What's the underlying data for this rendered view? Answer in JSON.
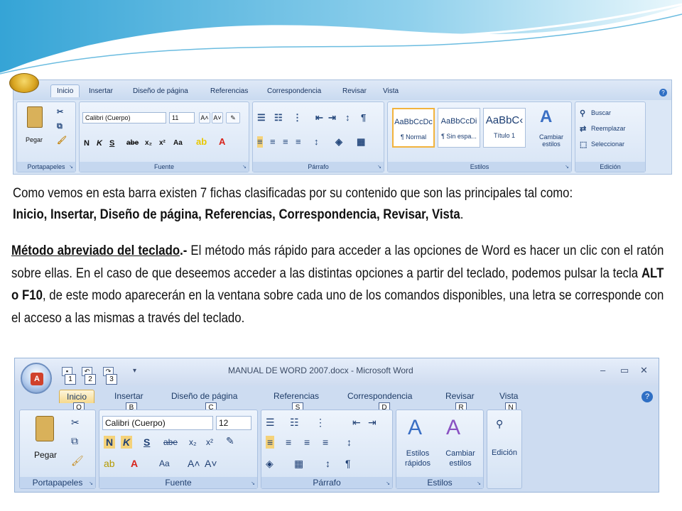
{
  "ribbon1": {
    "tabs": [
      "Inicio",
      "Insertar",
      "Diseño de página",
      "Referencias",
      "Correspondencia",
      "Revisar",
      "Vista"
    ],
    "groups": {
      "portapapeles": {
        "label": "Portapapeles",
        "paste_label": "Pegar"
      },
      "fuente": {
        "label": "Fuente",
        "font_name": "Calibri (Cuerpo)",
        "font_size": "11"
      },
      "parrafo": {
        "label": "Párrafo"
      },
      "estilos": {
        "label": "Estilos",
        "styles": [
          {
            "sample": "AaBbCcDc",
            "name": "¶ Normal"
          },
          {
            "sample": "AaBbCcDi",
            "name": "¶ Sin espa..."
          },
          {
            "sample": "AaBbC‹",
            "name": "Título 1"
          }
        ],
        "change_styles": "Cambiar estilos"
      },
      "edicion": {
        "label": "Edición",
        "buscar": "Buscar",
        "reemplazar": "Reemplazar",
        "seleccionar": "Seleccionar"
      }
    }
  },
  "paragraph1": {
    "text": "Como vemos en esta barra existen 7 fichas clasificadas por su contenido que son las principales tal como: ",
    "bold": "Inicio, Insertar, Diseño de página, Referencias, Correspondencia, Revisar, Vista",
    "end": "."
  },
  "paragraph2": {
    "lead": "Método abreviado del teclado",
    "dash": ".- ",
    "part1": " El método más rápido para acceder a las opciones de Word es hacer un clic con el ratón sobre ellas. En el caso de que deseemos acceder a las distintas opciones a partir del teclado, podemos pulsar la tecla ",
    "keys": "ALT o F10",
    "part2": ", de este modo aparecerán en la ventana sobre cada uno de los comandos disponibles, una letra se corresponde con el acceso a las mismas a través del teclado."
  },
  "ribbon2": {
    "window_title": "MANUAL DE WORD 2007.docx - Microsoft Word",
    "qat_keys": [
      "1",
      "2",
      "3"
    ],
    "tabs": [
      {
        "label": "Inicio",
        "key": "O"
      },
      {
        "label": "Insertar",
        "key": "B"
      },
      {
        "label": "Diseño de página",
        "key": "C"
      },
      {
        "label": "Referencias",
        "key": "S"
      },
      {
        "label": "Correspondencia",
        "key": "D"
      },
      {
        "label": "Revisar",
        "key": "R"
      },
      {
        "label": "Vista",
        "key": "N"
      }
    ],
    "groups": {
      "portapapeles": {
        "label": "Portapapeles",
        "paste_label": "Pegar"
      },
      "fuente": {
        "label": "Fuente",
        "font_name": "Calibri (Cuerpo)",
        "font_size": "12"
      },
      "parrafo": {
        "label": "Párrafo"
      },
      "estilos": {
        "label": "Estilos",
        "quick_styles": "Estilos rápidos",
        "change_styles": "Cambiar estilos"
      },
      "edicion": {
        "label": "Edición"
      }
    }
  },
  "colors": {
    "accent": "#2f6fc4",
    "highlight": "#f6d98d",
    "ribbon": "#dbe7f6"
  }
}
